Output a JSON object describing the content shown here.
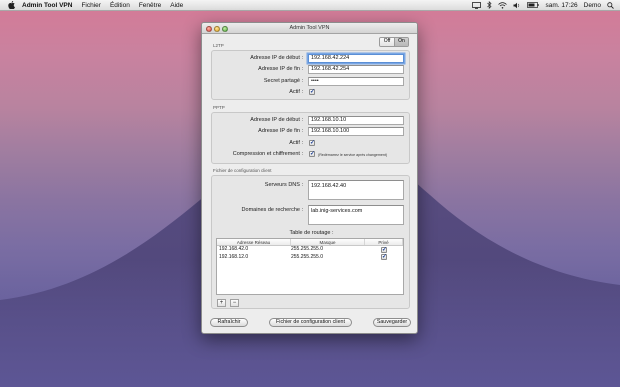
{
  "menubar": {
    "app_name": "Admin Tool VPN",
    "items": [
      "Fichier",
      "Édition",
      "Fenêtre",
      "Aide"
    ],
    "clock": "sam. 17:26",
    "user": "Demo"
  },
  "window": {
    "title": "Admin Tool VPN",
    "toggle": {
      "off_label": "Off",
      "on_label": "On",
      "selected": "On"
    }
  },
  "l2tp": {
    "section_title": "L2TP",
    "start_ip_label": "Adresse IP de début :",
    "start_ip_value": "192.168.42.224",
    "end_ip_label": "Adresse IP de fin :",
    "end_ip_value": "192.168.42.254",
    "secret_label": "Secret partagé :",
    "secret_value": "••••",
    "active_label": "Actif :",
    "active_checked": true
  },
  "pptp": {
    "section_title": "PPTP",
    "start_ip_label": "Adresse IP de début :",
    "start_ip_value": "192.168.10.10",
    "end_ip_label": "Adresse IP de fin :",
    "end_ip_value": "192.168.10.100",
    "active_label": "Actif :",
    "active_checked": true,
    "compression_label": "Compression et chiffrement :",
    "compression_checked": true,
    "compression_note": "(Redémarrez le service après changement)"
  },
  "client_config": {
    "section_title": "Fichier de configuration client",
    "dns_label": "Serveurs DNS :",
    "dns_value": "192.168.42.40",
    "search_domains_label": "Domaines de recherche :",
    "search_domains_value": "lab.inig-services.com",
    "routing_table_label": "Table de routage :",
    "columns": [
      "Adresse Réseau",
      "Masque",
      "Privé"
    ],
    "rows": [
      {
        "network": "192.168.42.0",
        "mask": "255.255.255.0",
        "private": true
      },
      {
        "network": "192.168.12.0",
        "mask": "255.255.255.0",
        "private": true
      }
    ],
    "add_label": "+",
    "remove_label": "−"
  },
  "buttons": {
    "refresh": "Rafraîchir",
    "client_file": "Fichier de configuration client",
    "save": "Sauvegarder"
  },
  "colors": {
    "focus_ring": "#7aa7e4",
    "check_mark": "#1c3f94",
    "close_light": "#e0443a",
    "min_light": "#e1a31c",
    "max_light": "#4da73a"
  }
}
